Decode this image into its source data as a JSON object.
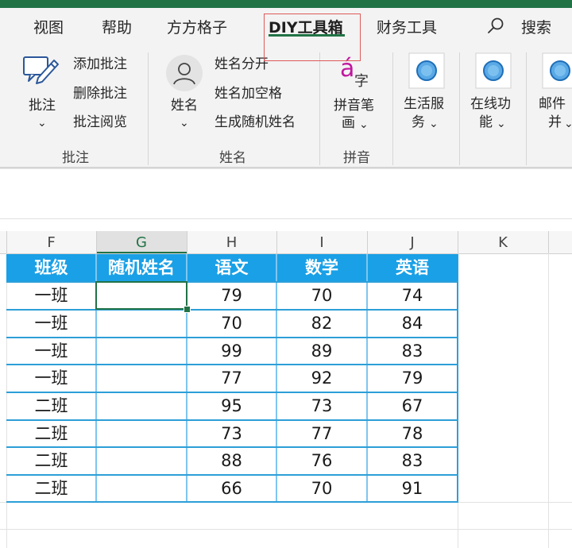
{
  "tabs": [
    {
      "label": "视图"
    },
    {
      "label": "帮助"
    },
    {
      "label": "方方格子"
    },
    {
      "label": "DIY工具箱"
    },
    {
      "label": "财务工具"
    },
    {
      "label": "搜索"
    }
  ],
  "ribbon": {
    "annotation": {
      "button_label": "批注",
      "add": "添加批注",
      "delete": "删除批注",
      "view": "批注阅览",
      "group": "批注"
    },
    "name": {
      "button_label": "姓名",
      "split": "姓名分开",
      "add_space": "姓名加空格",
      "random": "生成随机姓名",
      "group": "姓名"
    },
    "pinyin": {
      "icon_letter": "á",
      "icon_char": "字",
      "button_line1": "拼音笔",
      "button_line2": "画",
      "group": "拼音"
    },
    "life": {
      "line1": "生活服",
      "line2": "务"
    },
    "online": {
      "line1": "在线功",
      "line2": "能"
    },
    "mail": {
      "line1": "邮件",
      "line2": "并"
    },
    "dropdown_glyph": "⌄"
  },
  "columns": [
    "F",
    "G",
    "H",
    "I",
    "J",
    "K"
  ],
  "table": {
    "headers": [
      "班级",
      "随机姓名",
      "语文",
      "数学",
      "英语"
    ],
    "rows": [
      [
        "一班",
        "",
        "79",
        "70",
        "74"
      ],
      [
        "一班",
        "",
        "70",
        "82",
        "84"
      ],
      [
        "一班",
        "",
        "99",
        "89",
        "83"
      ],
      [
        "一班",
        "",
        "77",
        "92",
        "79"
      ],
      [
        "二班",
        "",
        "95",
        "73",
        "67"
      ],
      [
        "二班",
        "",
        "73",
        "77",
        "78"
      ],
      [
        "二班",
        "",
        "88",
        "76",
        "83"
      ],
      [
        "二班",
        "",
        "66",
        "70",
        "91"
      ]
    ]
  },
  "colors": {
    "accent_green": "#217346",
    "table_header_blue": "#1aa0e6",
    "table_border_blue": "#2d9fd8",
    "highlight_red": "#e05a5a"
  }
}
